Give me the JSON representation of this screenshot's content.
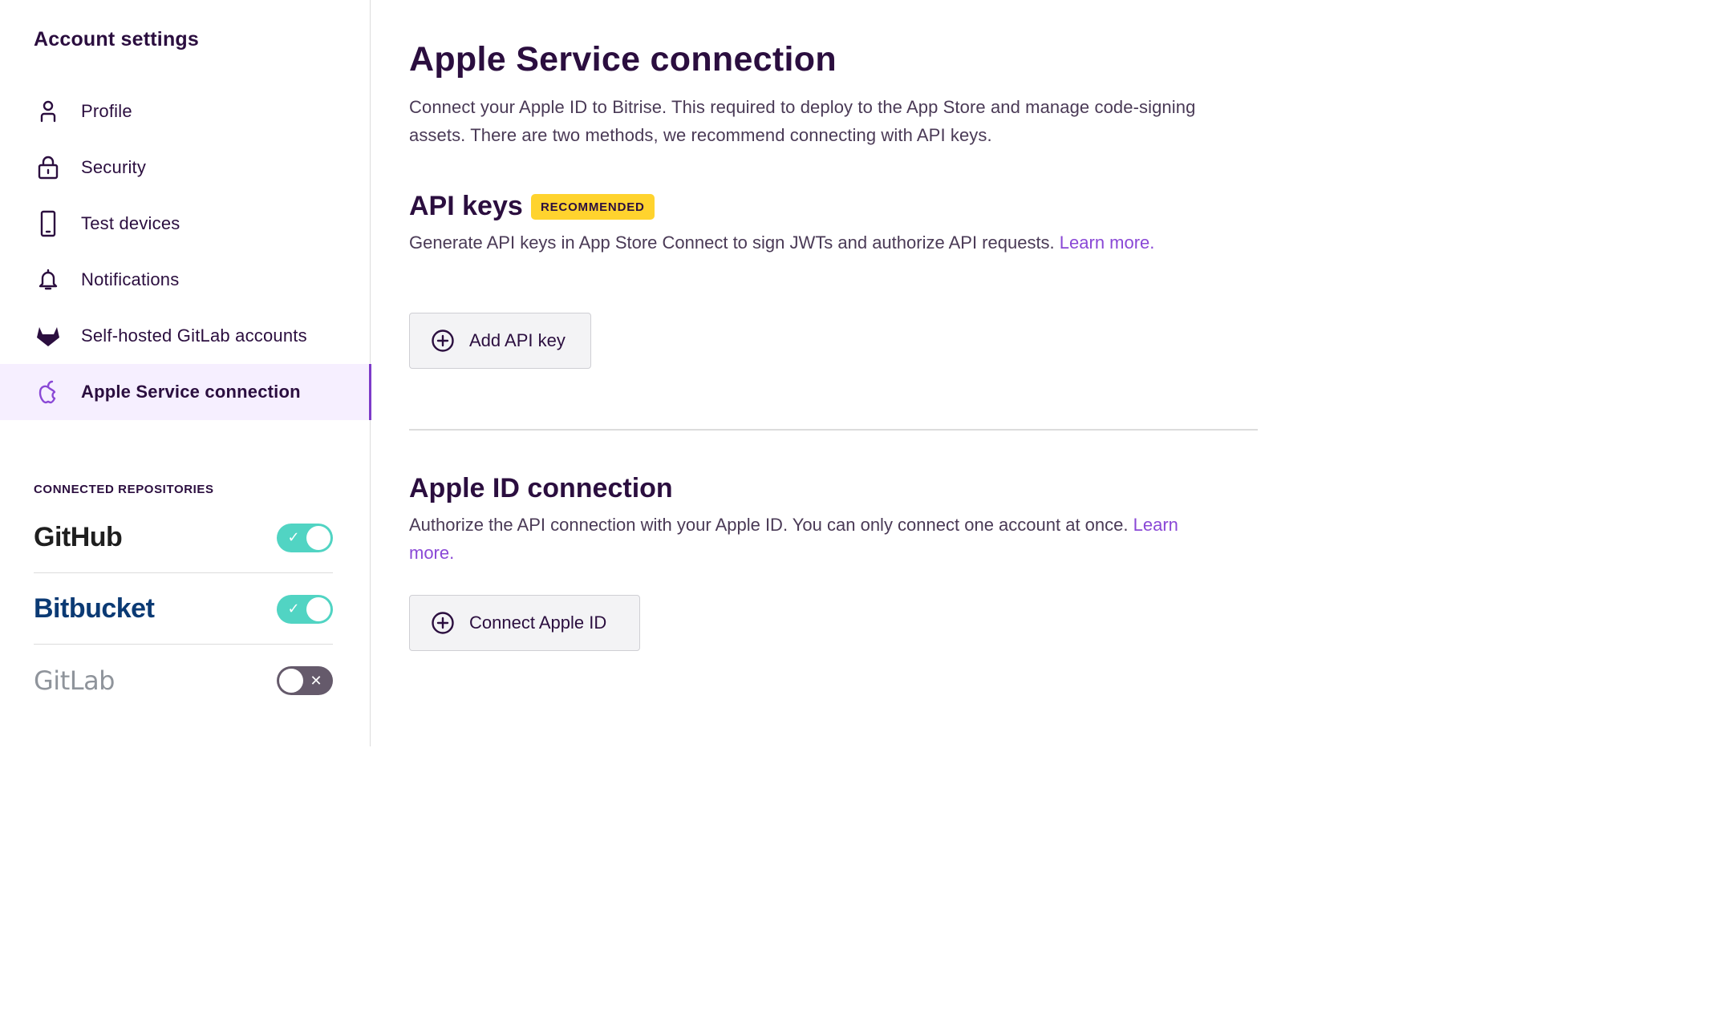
{
  "sidebar": {
    "title": "Account settings",
    "items": [
      {
        "label": "Profile",
        "icon": "person-icon"
      },
      {
        "label": "Security",
        "icon": "lock-icon"
      },
      {
        "label": "Test devices",
        "icon": "phone-icon"
      },
      {
        "label": "Notifications",
        "icon": "bell-icon"
      },
      {
        "label": "Self-hosted GitLab accounts",
        "icon": "gitlab-icon"
      },
      {
        "label": "Apple Service connection",
        "icon": "apple-icon",
        "active": true
      }
    ],
    "repos_title": "CONNECTED REPOSITORIES",
    "repos": [
      {
        "name": "GitHub",
        "connected": true
      },
      {
        "name": "Bitbucket",
        "connected": true
      },
      {
        "name": "GitLab",
        "connected": false
      }
    ]
  },
  "main": {
    "title": "Apple Service connection",
    "description": "Connect your Apple ID to Bitrise. This required to deploy to the App Store and manage code-signing assets. There are two methods, we recommend connecting with API keys.",
    "api_keys": {
      "title": "API keys",
      "badge": "RECOMMENDED",
      "description": "Generate API keys in App Store Connect to sign JWTs and authorize API requests. ",
      "learn_more": "Learn more.",
      "button": "Add API key"
    },
    "apple_id": {
      "title": "Apple ID connection",
      "description": "Authorize the API connection with your Apple ID. You can only connect one account at once. ",
      "learn_more": "Learn more.",
      "button": "Connect Apple ID"
    }
  },
  "colors": {
    "primary_text": "#2b0e3f",
    "accent": "#8a48d6",
    "badge": "#ffd32e",
    "toggle_on": "#51d4c3",
    "toggle_off": "#655a6b",
    "active_bg": "#f6efff"
  }
}
